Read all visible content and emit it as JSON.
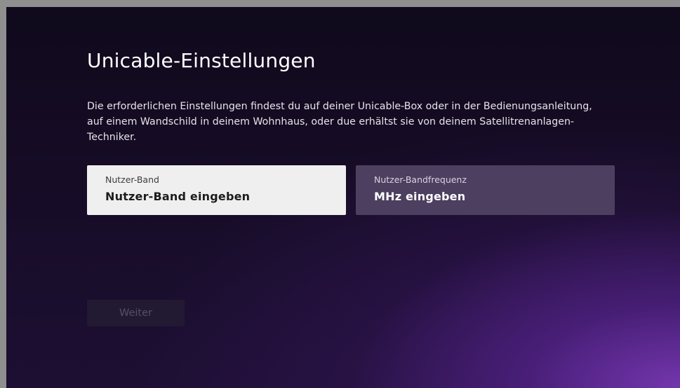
{
  "page": {
    "title": "Unicable-Einstellungen",
    "description": "Die erforderlichen Einstellungen findest du auf deiner Unicable-Box oder in der Bedienungsanleitung, auf einem Wandschild in deinem Wohnhaus, oder due erhältst sie von deinem Satellitrenanlagen-Techniker."
  },
  "fields": [
    {
      "label": "Nutzer-Band",
      "placeholder": "Nutzer-Band eingeben",
      "focused": true
    },
    {
      "label": "Nutzer-Bandfrequenz",
      "placeholder": "MHz eingeben",
      "focused": false
    }
  ],
  "actions": {
    "next_label": "Weiter",
    "next_enabled": false
  },
  "colors": {
    "background_top": "#100a1c",
    "background_glow": "#803cbe",
    "field_focused_bg": "#efefef",
    "field_unfocused_bg": "#4c3f5f",
    "button_disabled_bg": "#221932",
    "button_disabled_text": "#55506a"
  }
}
